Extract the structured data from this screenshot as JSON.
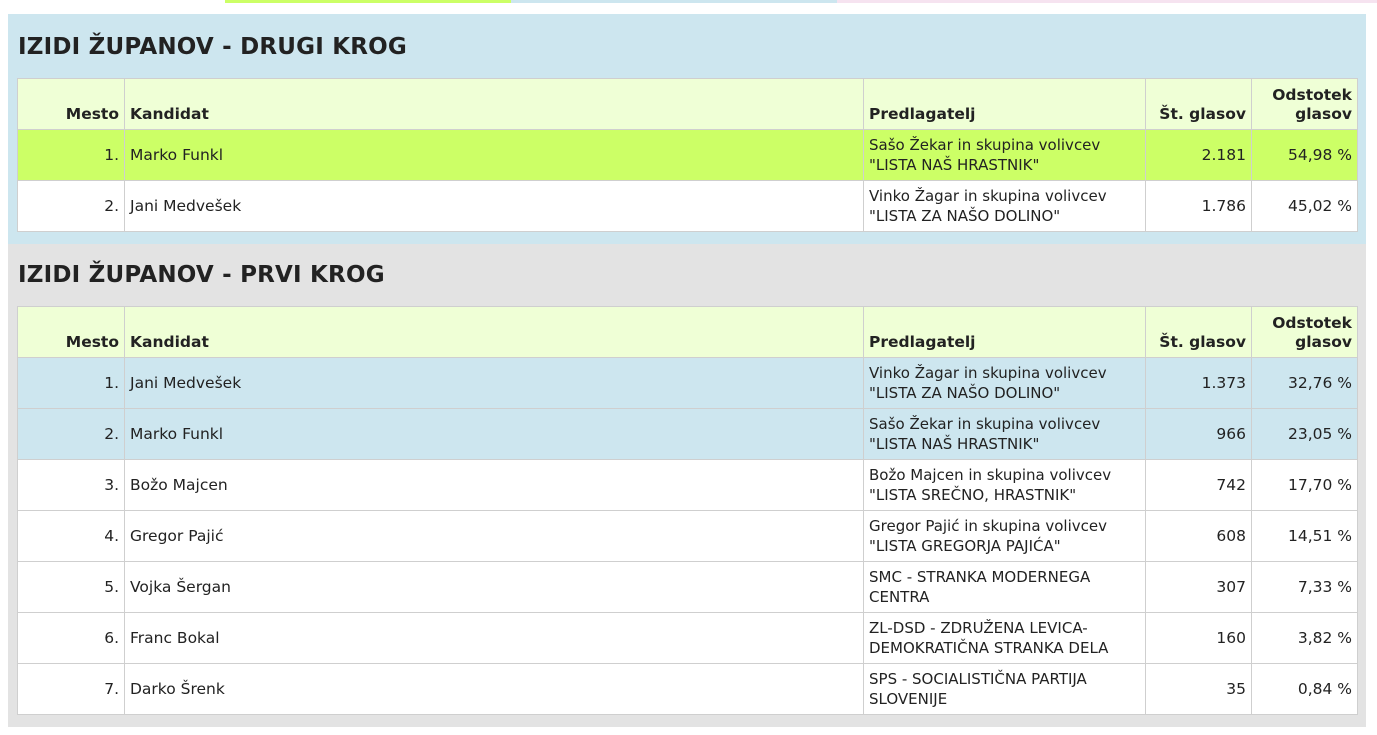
{
  "colors": {
    "top_bar": [
      "#ffffff",
      "#ccff66",
      "#cde6ef",
      "#f6e3f0"
    ],
    "second_round_bg": "#cde6ef",
    "first_round_bg": "#e3e3e3",
    "header_row": "#efffd6",
    "winner_row": "#ccff66",
    "runoff_row": "#cde6ef"
  },
  "second_round": {
    "title": "IZIDI ŽUPANOV - DRUGI KROG",
    "headers": {
      "place": "Mesto",
      "candidate": "Kandidat",
      "proposer": "Predlagatelj",
      "votes": "Št. glasov",
      "percent": "Odstotek glasov"
    },
    "rows": [
      {
        "place": "1.",
        "candidate": "Marko Funkl",
        "proposer": "Sašo Žekar in skupina volivcev \"LISTA NAŠ HRASTNIK\"",
        "votes": "2.181",
        "percent": "54,98 %"
      },
      {
        "place": "2.",
        "candidate": "Jani Medvešek",
        "proposer": "Vinko Žagar in skupina volivcev \"LISTA ZA NAŠO DOLINO\"",
        "votes": "1.786",
        "percent": "45,02 %"
      }
    ]
  },
  "first_round": {
    "title": "IZIDI ŽUPANOV - PRVI KROG",
    "headers": {
      "place": "Mesto",
      "candidate": "Kandidat",
      "proposer": "Predlagatelj",
      "votes": "Št. glasov",
      "percent": "Odstotek glasov"
    },
    "rows": [
      {
        "place": "1.",
        "candidate": "Jani Medvešek",
        "proposer": "Vinko Žagar in skupina volivcev \"LISTA ZA NAŠO DOLINO\"",
        "votes": "1.373",
        "percent": "32,76 %"
      },
      {
        "place": "2.",
        "candidate": "Marko Funkl",
        "proposer": "Sašo Žekar in skupina volivcev \"LISTA NAŠ HRASTNIK\"",
        "votes": "966",
        "percent": "23,05 %"
      },
      {
        "place": "3.",
        "candidate": "Božo Majcen",
        "proposer": "Božo Majcen in skupina volivcev \"LISTA SREČNO, HRASTNIK\"",
        "votes": "742",
        "percent": "17,70 %"
      },
      {
        "place": "4.",
        "candidate": "Gregor Pajić",
        "proposer": "Gregor Pajić in skupina volivcev \"LISTA GREGORJA PAJIĆA\"",
        "votes": "608",
        "percent": "14,51 %"
      },
      {
        "place": "5.",
        "candidate": "Vojka Šergan",
        "proposer": "SMC - STRANKA MODERNEGA CENTRA",
        "votes": "307",
        "percent": "7,33 %"
      },
      {
        "place": "6.",
        "candidate": "Franc Bokal",
        "proposer": "ZL-DSD - ZDRUŽENA LEVICA-DEMOKRATIČNA STRANKA DELA",
        "votes": "160",
        "percent": "3,82 %"
      },
      {
        "place": "7.",
        "candidate": "Darko Šrenk",
        "proposer": "SPS - SOCIALISTIČNA PARTIJA SLOVENIJE",
        "votes": "35",
        "percent": "0,84 %"
      }
    ]
  }
}
